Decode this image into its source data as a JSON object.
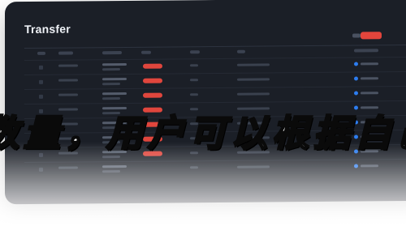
{
  "window": {
    "title": "Transfer"
  },
  "overlay": {
    "text": "数量，用户可以根据自己的"
  },
  "colors": {
    "window_bg": "#1b1f27",
    "accent_red": "#e2453c",
    "status_blue": "#2d7df0",
    "overlay_text": "#ffffff",
    "overlay_stroke": "#0a0a0a"
  },
  "table": {
    "row_count": 8,
    "rows_with_red_pill": [
      0,
      1,
      2,
      3,
      4,
      5,
      6
    ]
  }
}
